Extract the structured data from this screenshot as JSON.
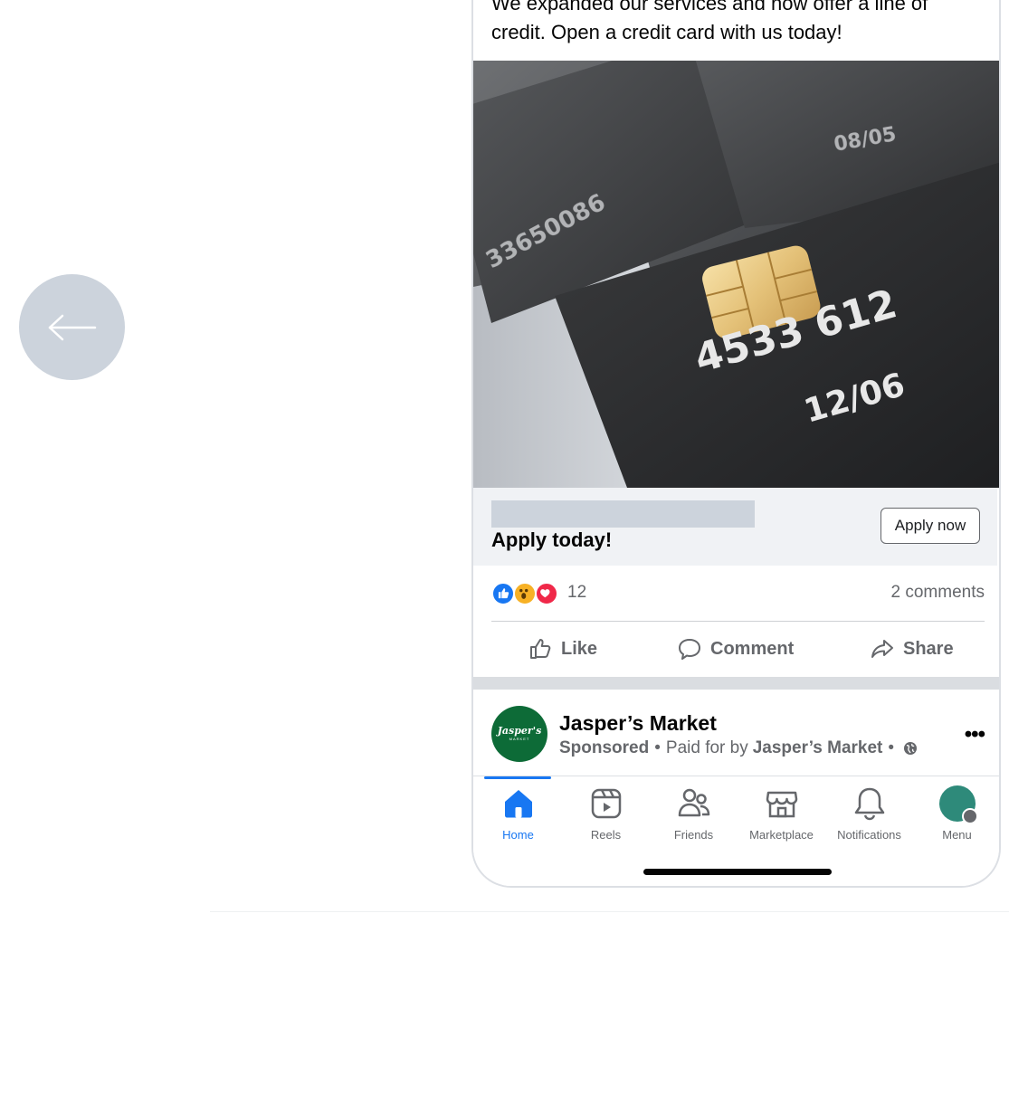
{
  "nav": {
    "back_icon": "arrow-left-icon"
  },
  "post1": {
    "text": "We expanded our services and now offer a line of credit. Open a credit card with us today!",
    "image_subject": "credit-cards",
    "card_number_fragment": "4533 612",
    "card_expiry": "12/06",
    "cta_title": "Apply today!",
    "cta_button": "Apply now",
    "reaction_count": "12",
    "comments": "2 comments",
    "actions": {
      "like": "Like",
      "comment": "Comment",
      "share": "Share"
    }
  },
  "post2": {
    "logo_text": "Jasper's",
    "logo_subtext": "MARKET",
    "page_name": "Jasper’s Market",
    "sponsored": "Sponsored",
    "paid_for_prefix": "Paid for by",
    "paid_for_name": "Jasper’s Market",
    "separator": "•",
    "more": "•••"
  },
  "tabbar": {
    "tabs": [
      {
        "label": "Home",
        "icon": "home-icon",
        "active": true
      },
      {
        "label": "Reels",
        "icon": "reels-icon"
      },
      {
        "label": "Friends",
        "icon": "friends-icon"
      },
      {
        "label": "Marketplace",
        "icon": "marketplace-icon"
      },
      {
        "label": "Notifications",
        "icon": "bell-icon"
      },
      {
        "label": "Menu",
        "icon": "avatar"
      }
    ]
  },
  "colors": {
    "accent": "#1877f2",
    "secondary_text": "#65676b",
    "placeholder": "#ccd3dc",
    "brand_green": "#0d6b37"
  }
}
